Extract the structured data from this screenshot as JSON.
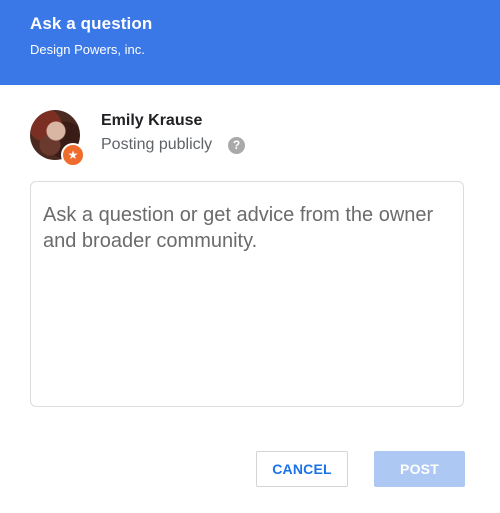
{
  "dialog": {
    "title": "Ask a question",
    "business_name": "Design Powers, inc."
  },
  "user": {
    "name": "Emily Krause",
    "visibility": "Posting publicly",
    "help_icon_glyph": "?",
    "badge_icon": "star-badge-icon"
  },
  "question_input": {
    "placeholder": "Ask a question or get advice from the owner and broader community."
  },
  "actions": {
    "cancel_label": "CANCEL",
    "post_label": "POST"
  },
  "colors": {
    "header_bg": "#3b78e7",
    "accent": "#1a73e8",
    "post_disabled_bg": "#aec8f4",
    "badge": "#ef6c2d"
  }
}
